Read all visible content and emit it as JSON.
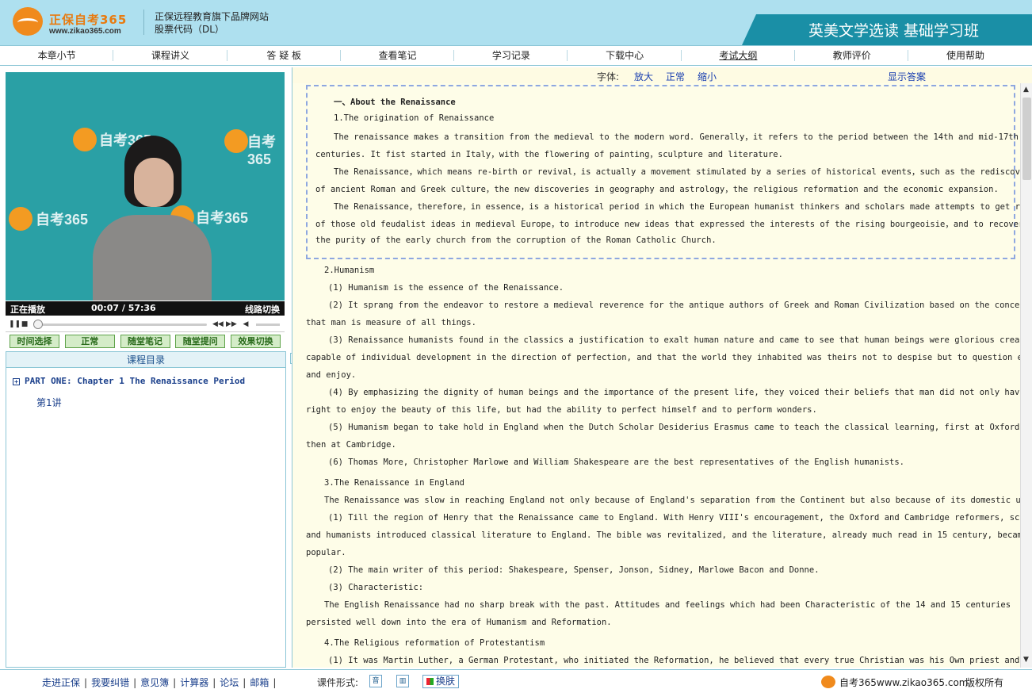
{
  "header": {
    "brand": "正保自考365",
    "url": "www.zikao365.com",
    "tagline1": "正保远程教育旗下品牌网站",
    "tagline2": "股票代码（DL）",
    "course_title": "英美文学选读 基础学习班"
  },
  "nav": {
    "items": [
      {
        "label": "本章小节"
      },
      {
        "label": "课程讲义"
      },
      {
        "label": "答 疑 板"
      },
      {
        "label": "查看笔记"
      },
      {
        "label": "学习记录"
      },
      {
        "label": "下载中心"
      },
      {
        "label": "考试大纲"
      },
      {
        "label": "教师评价"
      },
      {
        "label": "使用帮助"
      }
    ]
  },
  "video": {
    "status": "正在播放",
    "time": "00:07 / 57:36",
    "switch": "线路切换",
    "watermark": "自考365",
    "watermark_url": "www.zikao365.com"
  },
  "controls": {
    "buttons": [
      {
        "label": "时间选择"
      },
      {
        "label": "正常"
      },
      {
        "label": "随堂笔记"
      },
      {
        "label": "随堂提问"
      },
      {
        "label": "效果切换"
      }
    ]
  },
  "toc": {
    "title": "课程目录",
    "chapter": "PART ONE: Chapter 1  The Renaissance Period",
    "lesson": "第1讲"
  },
  "toolbar": {
    "font_label": "字体:",
    "bigger": "放大",
    "normal": "正常",
    "smaller": "缩小",
    "show_answer": "显示答案"
  },
  "content": {
    "lines": [
      "一、About the Renaissance",
      "1.The origination of Renaissance",
      "The renaissance makes a transition from the medieval to the modern word. Generally，it refers to the period between the 14th and mid-17th",
      "centuries. It fist started in Italy，with the flowering of painting，sculpture and literature.",
      "The Renaissance，which means re-birth or revival，is actually a movement stimulated by a series of historical events，such as the rediscovery",
      "of ancient Roman and Greek culture，the new discoveries in geography and astrology，the religious reformation and the economic expansion.",
      "The Renaissance，therefore，in essence，is a historical period in which the European humanist thinkers and scholars made attempts to get rid",
      "of those old feudalist ideas in medieval Europe，to introduce new ideas that expressed the interests of the rising bourgeoisie，and to recover",
      "the purity of the early church from the corruption of the Roman Catholic Church.",
      "2.Humanism",
      "(1) Humanism is the essence of the Renaissance.",
      "(2) It sprang from the endeavor to restore a medieval reverence for the antique authors of Greek and Roman Civilization based on the conception",
      "that man is measure of all things.",
      "(3) Renaissance humanists found in the classics a justification to exalt human nature and came to see that human beings were glorious creatures",
      "capable of individual development in the direction of perfection, and that the world they inhabited was theirs not to despise but to question explore",
      "and enjoy.",
      "(4) By emphasizing the dignity of human beings and the importance of the present life, they voiced their beliefs that man did not only have the",
      "right to enjoy the beauty of this life, but had the ability to perfect himself and to perform wonders.",
      "(5) Humanism began to take hold in England when the Dutch Scholar Desiderius Erasmus came to teach the classical learning, first at Oxford and",
      "then at Cambridge.",
      "(6) Thomas More, Christopher Marlowe and William Shakespeare are the best representatives of the English humanists.",
      "3.The Renaissance in England",
      "The Renaissance was slow in reaching England not only because of England's separation from the Continent but also because of its domestic unrest.",
      "(1) Till the region of Henry that the Renaissance came to England. With Henry VIII's encouragement, the Oxford and Cambridge reformers, scholars",
      "and humanists introduced classical literature to England. The bible was revitalized, and the literature, already much read in 15 century, became more",
      "popular.",
      "(2) The main writer of this period: Shakespeare, Spenser, Jonson, Sidney, Marlowe Bacon and Donne.",
      "(3) Characteristic:",
      "The English Renaissance had no sharp break with the past. Attitudes and feelings which had been Characteristic of the 14 and 15 centuries",
      "persisted well down into the era of Humanism and Reformation.",
      "4.The Religious reformation of Protestantism",
      "(1) It was Martin Luther, a German Protestant, who initiated the Reformation, he believed that every true Christian was his Own priest and was"
    ]
  },
  "footer": {
    "links": [
      {
        "label": "走进正保"
      },
      {
        "label": "我要纠错"
      },
      {
        "label": "意见簿"
      },
      {
        "label": "计算器"
      },
      {
        "label": "论坛"
      },
      {
        "label": "邮箱"
      }
    ],
    "format_label": "课件形式:",
    "audio_icon": "音",
    "skin_label": "换肤",
    "site": "自考365www.zikao365.com",
    "copyright": "版权所有"
  }
}
